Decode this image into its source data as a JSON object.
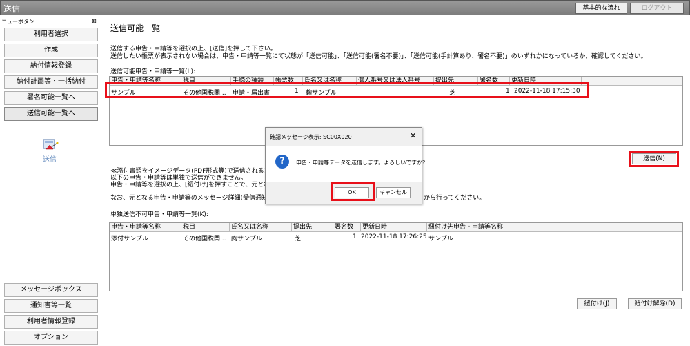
{
  "titlebar": {
    "title": "送信",
    "basic_flow_button": "基本的な流れ",
    "logout_button": "ログアウト"
  },
  "sidebar": {
    "header_label": "ニューボタン",
    "pin_glyph": "⊠",
    "top_items": [
      {
        "label": "利用者選択"
      },
      {
        "label": "作成"
      },
      {
        "label": "納付情報登録"
      },
      {
        "label": "納付計画等・一括納付"
      },
      {
        "label": "署名可能一覧へ"
      },
      {
        "label": "送信可能一覧へ"
      }
    ],
    "active_icon": {
      "icon": "send-icon",
      "label": "送信"
    },
    "bottom_items": [
      {
        "label": "メッセージボックス"
      },
      {
        "label": "通知書等一覧"
      },
      {
        "label": "利用者情報登録"
      },
      {
        "label": "オプション"
      }
    ]
  },
  "main": {
    "page_title": "送信可能一覧",
    "instruction_1": "送信する申告・申請等を選択の上、[送信]を押して下さい。",
    "instruction_2": "送信したい帳票が表示されない場合は、申告・申請等一覧にて状態が「送信可能」、「送信可能(署名不要)」、「送信可能(手計算あり、署名不要)」のいずれかになっているか、確認してください。",
    "list1": {
      "label": "送信可能申告・申請等一覧(L):",
      "columns": [
        "申告・申請等名称",
        "税目",
        "手続の種類",
        "帳票数",
        "氏名又は名称",
        "個人番号又は法人番号",
        "提出先",
        "署名数",
        "更新日時"
      ],
      "rows": [
        {
          "name": "サンプル",
          "tax": "その他国税関...",
          "proc": "申請・届出書",
          "forms": "1",
          "person": "麹サンプル",
          "number": "",
          "dest": "芝",
          "sigs": "1",
          "updated": "2022-11-18 17:15:30"
        }
      ]
    },
    "send_button": "送信(N)",
    "note_1": "≪添付書類をイメージデータ(PDF形式等)で送信される方",
    "note_2": "以下の申告・申請等は単独で送信ができません。",
    "note_3": "申告・申請等を選択の上、[紐付け]を押すことで、元とな",
    "note_4a": "なお、元となる申告・申請等のメッセージ詳細(受信通知",
    "note_4b": "から行ってください。",
    "list2": {
      "label": "単独送信不可申告・申請等一覧(K):",
      "columns": [
        "申告・申請等名称",
        "税目",
        "氏名又は名称",
        "提出先",
        "署名数",
        "更新日時",
        "紐付け先申告・申請等名称"
      ],
      "rows": [
        {
          "name": "添付サンプル",
          "tax": "その他国税関...",
          "person": "麹サンプル",
          "dest": "芝",
          "sigs": "1",
          "updated": "2022-11-18 17:26:25",
          "link": "サンプル"
        }
      ]
    },
    "link_button": "紐付け(J)",
    "unlink_button": "紐付け解除(D)"
  },
  "dialog": {
    "title": "確認メッセージ表示: SC00X020",
    "close_glyph": "✕",
    "icon": "question-icon",
    "icon_glyph": "?",
    "message": "申告・申請等データを送信します。よろしいですか?",
    "ok_label": "OK",
    "cancel_label": "キャンセル"
  },
  "colors": {
    "highlight": "#e8101a",
    "question_icon": "#2266c8",
    "titlebar": "#8a8a8a"
  }
}
